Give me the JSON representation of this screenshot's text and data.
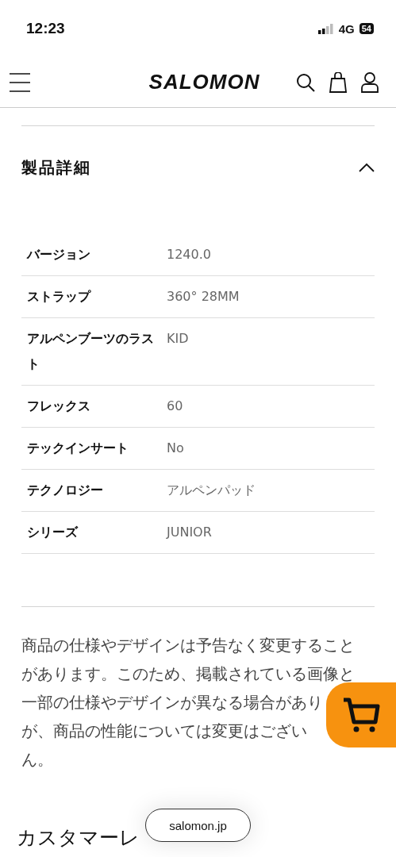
{
  "status_bar": {
    "time": "12:23",
    "network": "4G",
    "battery": "54"
  },
  "header": {
    "logo": "SALOMON"
  },
  "section": {
    "title": "製品詳細",
    "expanded": true,
    "rows": [
      {
        "label": "バージョン",
        "value": "1240.0"
      },
      {
        "label": "ストラップ",
        "value": "360° 28MM"
      },
      {
        "label": "アルペンブーツのラスト",
        "value": "KID"
      },
      {
        "label": "フレックス",
        "value": "60"
      },
      {
        "label": "テックインサート",
        "value": "No"
      },
      {
        "label": "テクノロジー",
        "value": "アルペンパッド"
      },
      {
        "label": "シリーズ",
        "value": "JUNIOR"
      }
    ]
  },
  "notice_lines": [
    "商品の仕様やデザインは予告なく変更すること",
    "があります。このため、掲載されている画像と",
    "一部の仕様やデザインが異なる場合があり",
    "が、商品の性能については変更はござい",
    "ん。"
  ],
  "next_section": {
    "title": "カスタマーレ"
  },
  "url_pill": "salomon.jp"
}
